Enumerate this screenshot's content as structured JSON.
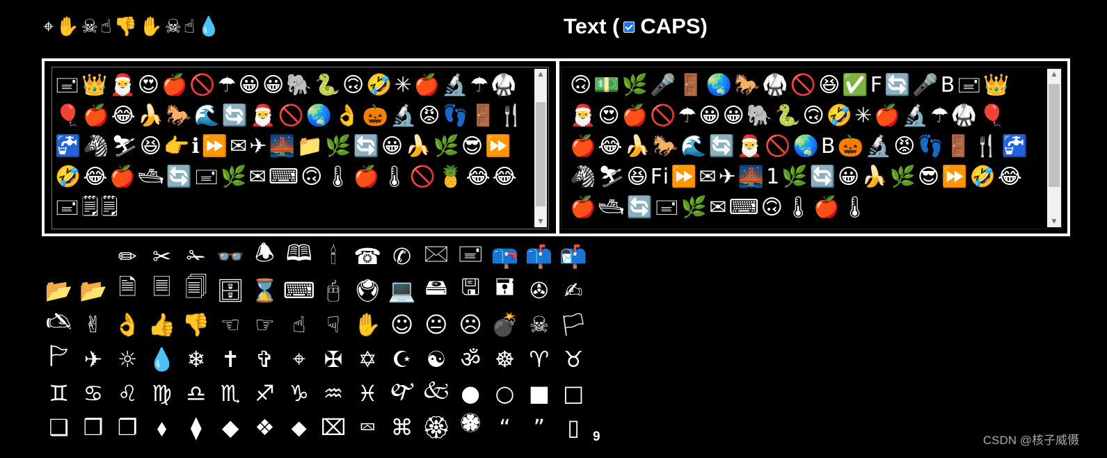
{
  "header": {
    "symbols": "⌖✋☠☝👎✋☠☝",
    "drop_symbol": "💧",
    "text_label": "Text (",
    "caps_label": "CAPS)",
    "caps_checked": true,
    "caps_color": "#1a73e8"
  },
  "left_box": {
    "content": "🖃👑🎅😍🍎🚫☂😀😀🐘🐍🙃🤣✳🍎🔬☂🥋🎈🍎😂🍌🐎🌊🔄🎅🚫🌏👌🎃🔬😡👣🚪🍴🚰🦓⛷😆👉ℹ⏩✉✈🌉📁🌿🔄😀🍌🌿😎⏩🤣😂🍎🛥🔄🖃🌿✉⌨🙃🌡🍎🌡🚫🍍😂😂🖃🗒🗒"
  },
  "right_box": {
    "content": "🙃💵🌿🎤🚪🌏🐎🥋🚫😆✅F🔄🎤B🖃👑🎅😍🍎🚫☂😀😀🐘🐍🙃🤣✳🍎🔬☂🥋🎈🍎😂🍌🐎🌊🔄🎅🚫🌏B🎃🔬😡👣🚪🍴🚰🦓⛷😆Fi⏩✉✈🌉1🌿🔄😀🍌🌿😎⏩🤣😂🍎🛥🔄🖃🌿✉⌨🙃🌡🍎🌡"
  },
  "glyphs": [
    " ",
    " ",
    "✏",
    "✂",
    "✁",
    "👓",
    "🕭",
    "🕮",
    "🕯",
    "☎",
    "✆",
    "🖂",
    "🖃",
    "📪",
    "📫",
    "📬",
    "📂",
    "📂",
    "🗎",
    "🗏",
    "🗐",
    "🗄",
    "⌛",
    "⌨",
    "🖰",
    "🖲",
    "💻",
    "🖴",
    "🖫",
    "🖬",
    "✇",
    "✍",
    "🖎",
    "✌",
    "👌",
    "👍",
    "👎",
    "☜",
    "☞",
    "☝",
    "☟",
    "✋",
    "☺",
    "😐",
    "☹",
    "💣",
    "☠",
    "🏳",
    "🏱",
    "✈",
    "☼",
    "💧",
    "❄",
    "✝",
    "✞",
    "⌖",
    "✠",
    "✡",
    "☪",
    "☯",
    "ॐ",
    "☸",
    "♈",
    "♉",
    "♊",
    "♋",
    "♌",
    "♍",
    "♎",
    "♏",
    "♐",
    "♑",
    "♒",
    "♓",
    "🙰",
    "🙵",
    "●",
    "○",
    "■",
    "□",
    "❑",
    "❒",
    "❐",
    "⬧",
    "⧫",
    "◆",
    "❖",
    "⬥",
    "⌧",
    "⮹",
    "⌘",
    "🏵",
    "🏶",
    "“",
    "”",
    "▯"
  ],
  "footer": {
    "number": "9",
    "watermark": "CSDN @核子威慑"
  }
}
